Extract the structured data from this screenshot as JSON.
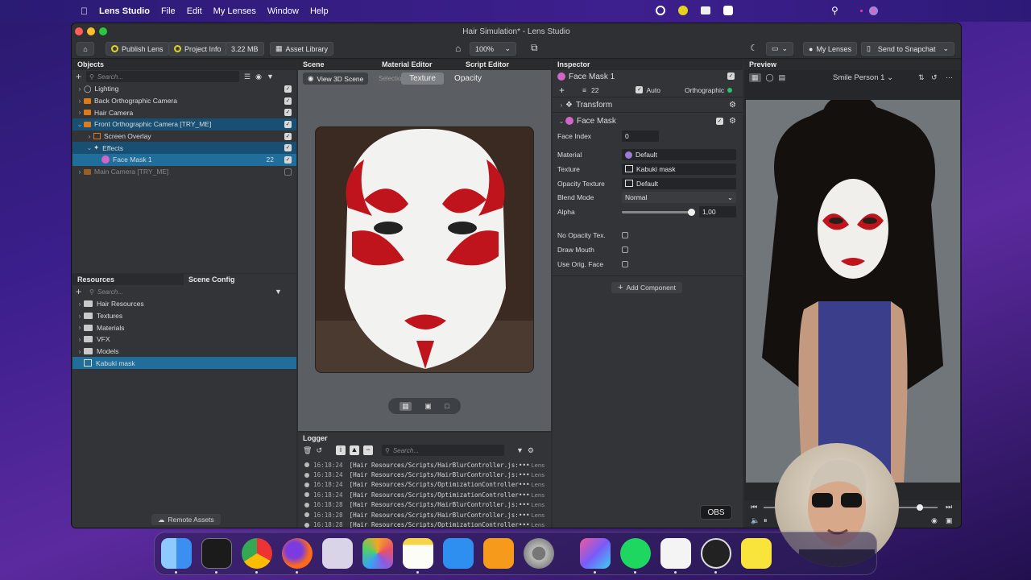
{
  "menubar": {
    "app_name": "Lens Studio",
    "items": [
      "File",
      "Edit",
      "My Lenses",
      "Window",
      "Help"
    ]
  },
  "window": {
    "title": "Hair Simulation* - Lens Studio"
  },
  "toolbar": {
    "publish_label": "Publish Lens",
    "project_info_label": "Project Info",
    "size_label": "3.22 MB",
    "asset_library_label": "Asset Library",
    "zoom_value": "100%",
    "my_lenses_label": "My Lenses",
    "send_label": "Send to Snapchat"
  },
  "objects": {
    "title": "Objects",
    "search_placeholder": "Search...",
    "items": [
      {
        "label": "Lighting"
      },
      {
        "label": "Back Orthographic Camera"
      },
      {
        "label": "Hair Camera"
      },
      {
        "label": "Front Orthographic Camera [TRY_ME]"
      },
      {
        "label": "Screen Overlay"
      },
      {
        "label": "Effects"
      },
      {
        "label": "Face Mask 1",
        "count": "22"
      },
      {
        "label": "Main Camera [TRY_ME]"
      }
    ]
  },
  "resources": {
    "tab1": "Resources",
    "tab2": "Scene Config",
    "search_placeholder": "Search...",
    "items": [
      "Hair Resources",
      "Textures",
      "Materials",
      "VFX",
      "Models",
      "Kabuki mask"
    ],
    "remote_assets_label": "Remote Assets"
  },
  "scene": {
    "tabs": [
      "Scene",
      "Material Editor",
      "Script Editor"
    ],
    "view3d_label": "View 3D Scene",
    "selection_label": "Selection",
    "texture_label": "Texture",
    "opacity_label": "Opacity"
  },
  "logger": {
    "title": "Logger",
    "search_placeholder": "Search...",
    "rows": [
      {
        "time": "16:18:24",
        "msg": "[Hair Resources/Scripts/HairBlurController.js:",
        "src": "Lens"
      },
      {
        "time": "16:18:24",
        "msg": "[Hair Resources/Scripts/HairBlurController.js:",
        "src": "Lens"
      },
      {
        "time": "16:18:24",
        "msg": "[Hair Resources/Scripts/OptimizationController",
        "src": "Lens"
      },
      {
        "time": "16:18:24",
        "msg": "[Hair Resources/Scripts/OptimizationController",
        "src": "Lens"
      },
      {
        "time": "16:18:28",
        "msg": "[Hair Resources/Scripts/HairBlurController.js:",
        "src": "Lens"
      },
      {
        "time": "16:18:28",
        "msg": "[Hair Resources/Scripts/HairBlurController.js:",
        "src": "Lens"
      },
      {
        "time": "16:18:28",
        "msg": "[Hair Resources/Scripts/OptimizationController",
        "src": "Lens"
      }
    ]
  },
  "inspector": {
    "title": "Inspector",
    "object_name": "Face Mask 1",
    "layer_count": "22",
    "auto_label": "Auto",
    "ortho_label": "Orthographic",
    "transform_label": "Transform",
    "component_label": "Face Mask",
    "props": {
      "face_index_label": "Face Index",
      "face_index_value": "0",
      "material_label": "Material",
      "material_value": "Default",
      "texture_label": "Texture",
      "texture_value": "Kabuki mask",
      "opacity_texture_label": "Opacity Texture",
      "opacity_texture_value": "Default",
      "blend_mode_label": "Blend Mode",
      "blend_mode_value": "Normal",
      "alpha_label": "Alpha",
      "alpha_value": "1,00",
      "no_opacity_label": "No Opacity Tex.",
      "draw_mouth_label": "Draw Mouth",
      "use_orig_label": "Use Orig. Face"
    },
    "add_component_label": "Add Component"
  },
  "preview": {
    "title": "Preview",
    "person_label": "Smile Person 1",
    "obs_label": "OBS"
  },
  "colors": {
    "accent": "#1f6e9c",
    "camera": "#e07a16",
    "mask_red": "#c0141c"
  }
}
